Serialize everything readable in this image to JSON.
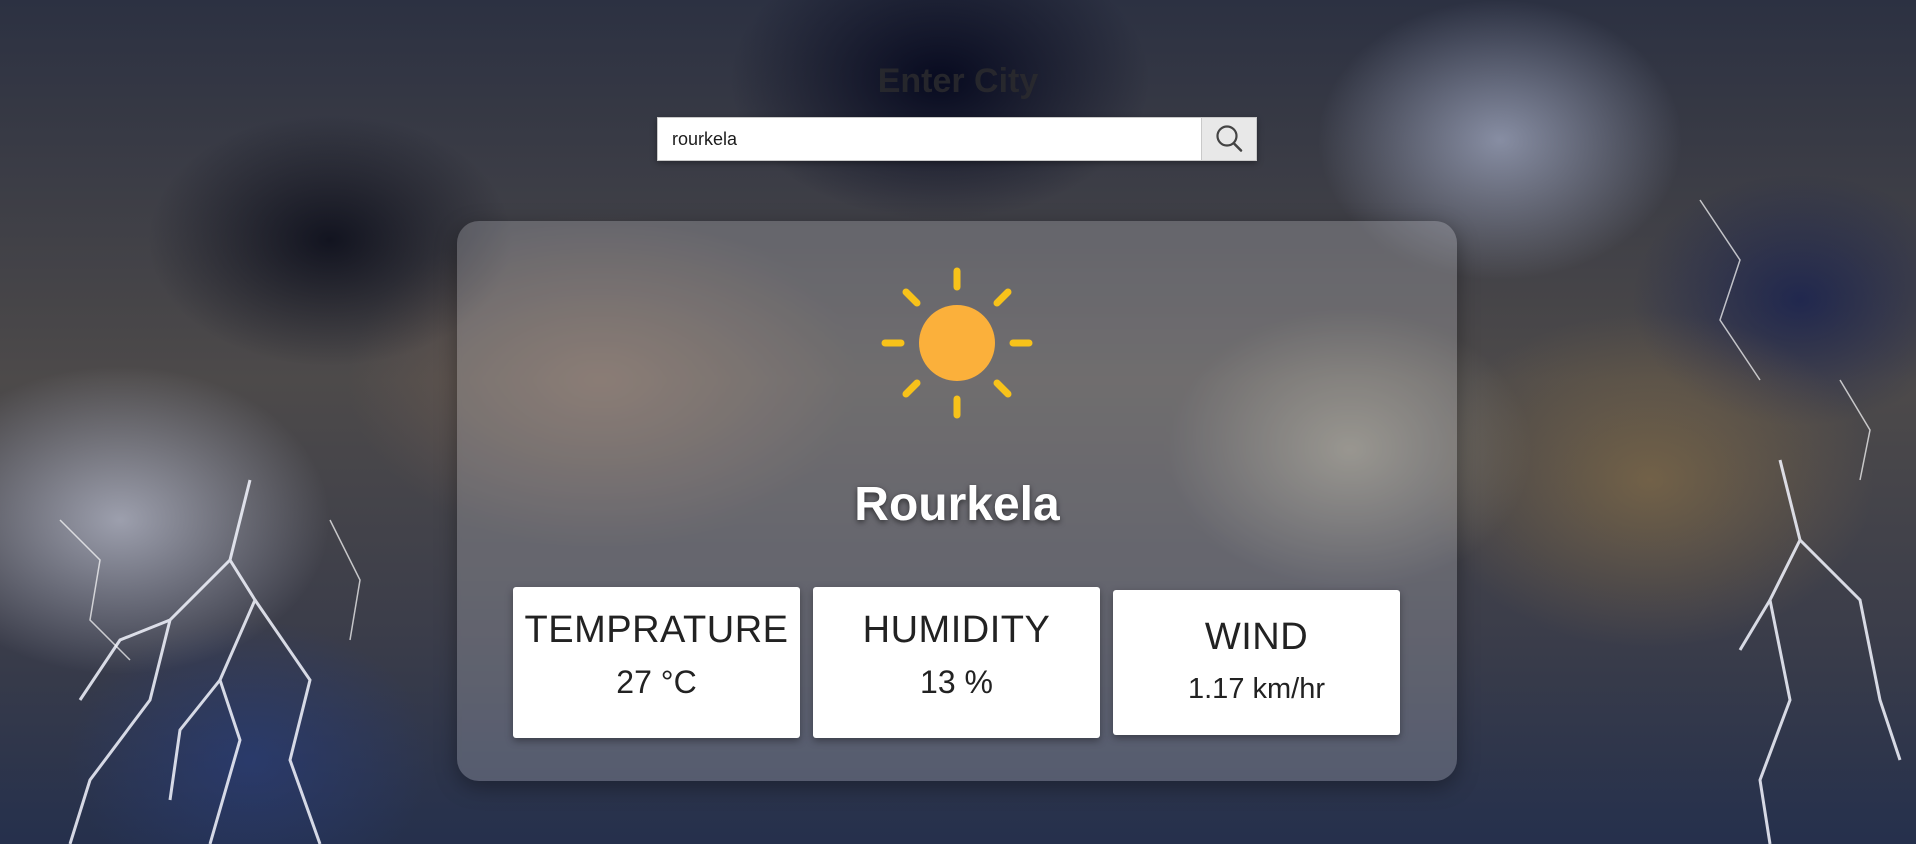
{
  "header": {
    "label": "Enter City"
  },
  "search": {
    "value": "rourkela",
    "button_icon": "search-icon"
  },
  "weather": {
    "icon": "sun-icon",
    "city": "Rourkela",
    "stats": [
      {
        "title": "TEMPRATURE",
        "value": "27 °C"
      },
      {
        "title": "HUMIDITY",
        "value": "13 %"
      },
      {
        "title": "WIND",
        "value": "1.17 km/hr"
      }
    ]
  },
  "colors": {
    "sun": "#FBB03B",
    "sun_rays": "#F7C21A",
    "card_bg": "rgba(235,235,240,0.22)",
    "stat_bg": "#FFFFFF"
  }
}
